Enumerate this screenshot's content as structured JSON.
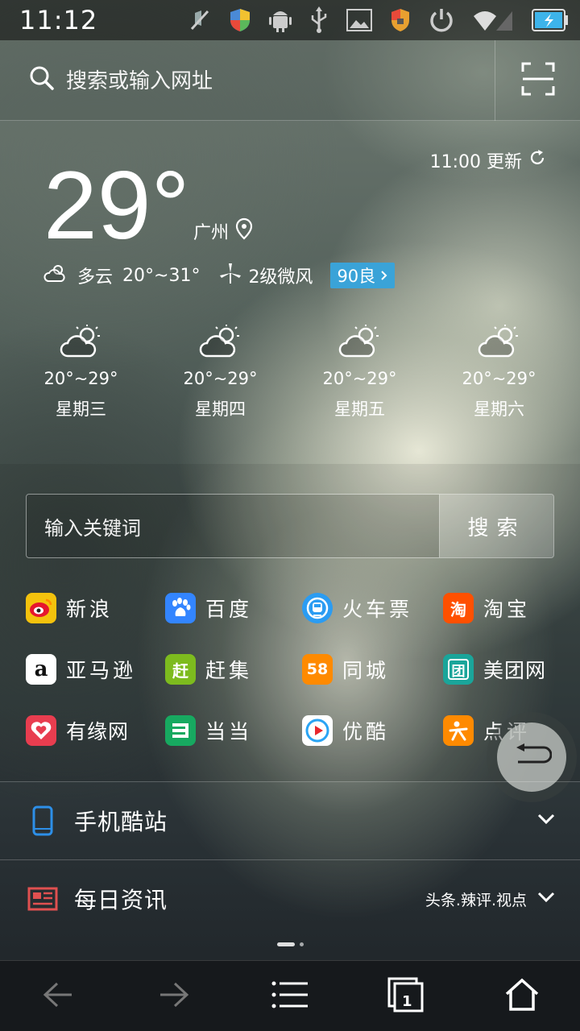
{
  "status_bar": {
    "time": "11:12",
    "icons": [
      "mute-icon",
      "shield-icon",
      "android-debug-icon",
      "usb-icon",
      "image-icon",
      "shield-lock-icon",
      "power-icon",
      "wifi-icon",
      "battery-charging-icon"
    ]
  },
  "header": {
    "search_placeholder": "搜索或输入网址",
    "icons": [
      "search-icon",
      "scan-icon"
    ]
  },
  "weather": {
    "update_time": "11:00 更新",
    "current_temp": "29°",
    "city": "广州",
    "condition": "多云",
    "temp_range": "20°~31°",
    "wind": "2级微风",
    "aqi": "90良",
    "forecast": [
      {
        "range": "20°~29°",
        "day": "星期三",
        "icon": "partly-cloudy-icon"
      },
      {
        "range": "20°~29°",
        "day": "星期四",
        "icon": "partly-cloudy-icon"
      },
      {
        "range": "20°~29°",
        "day": "星期五",
        "icon": "partly-cloudy-icon"
      },
      {
        "range": "20°~29°",
        "day": "星期六",
        "icon": "partly-cloudy-icon"
      }
    ]
  },
  "keyword_search": {
    "placeholder": "输入关键词",
    "button": "搜索"
  },
  "sites": [
    {
      "label": "新浪",
      "icon": "weibo-icon",
      "color": "#f4c20d"
    },
    {
      "label": "百度",
      "icon": "baidu-icon",
      "color": "#3385ff"
    },
    {
      "label": "火车票",
      "icon": "train-icon",
      "color": "#2b9cf2"
    },
    {
      "label": "淘宝",
      "icon": "taobao-icon",
      "color": "#ff5000"
    },
    {
      "label": "亚马逊",
      "icon": "amazon-icon",
      "color": "#ffffff"
    },
    {
      "label": "赶集",
      "icon": "ganji-icon",
      "color": "#7dbb1e"
    },
    {
      "label": "同城",
      "icon": "58-icon",
      "color": "#ff8a00"
    },
    {
      "label": "美团网",
      "icon": "meituan-icon",
      "color": "#1aa59a"
    },
    {
      "label": "有缘网",
      "icon": "youyuan-icon",
      "color": "#e83d4f"
    },
    {
      "label": "当当",
      "icon": "dangdang-icon",
      "color": "#17a960"
    },
    {
      "label": "优酷",
      "icon": "youku-icon",
      "color": "#ffffff"
    },
    {
      "label": "点评",
      "icon": "dianping-icon",
      "color": "#ff8a00"
    }
  ],
  "site_glyphs": {
    "ganji": "赶",
    "tongcheng": "58",
    "meituan": "团",
    "taobao": "淘",
    "amazon": "a"
  },
  "sections": [
    {
      "title": "手机酷站",
      "subtitle": "",
      "icon": "phone-icon"
    },
    {
      "title": "每日资讯",
      "subtitle": "头条.辣评.视点",
      "icon": "news-icon"
    }
  ],
  "bottom_nav": {
    "tab_count": "1",
    "icons": [
      "back-icon",
      "forward-icon",
      "menu-icon",
      "tabs-icon",
      "home-icon"
    ]
  }
}
